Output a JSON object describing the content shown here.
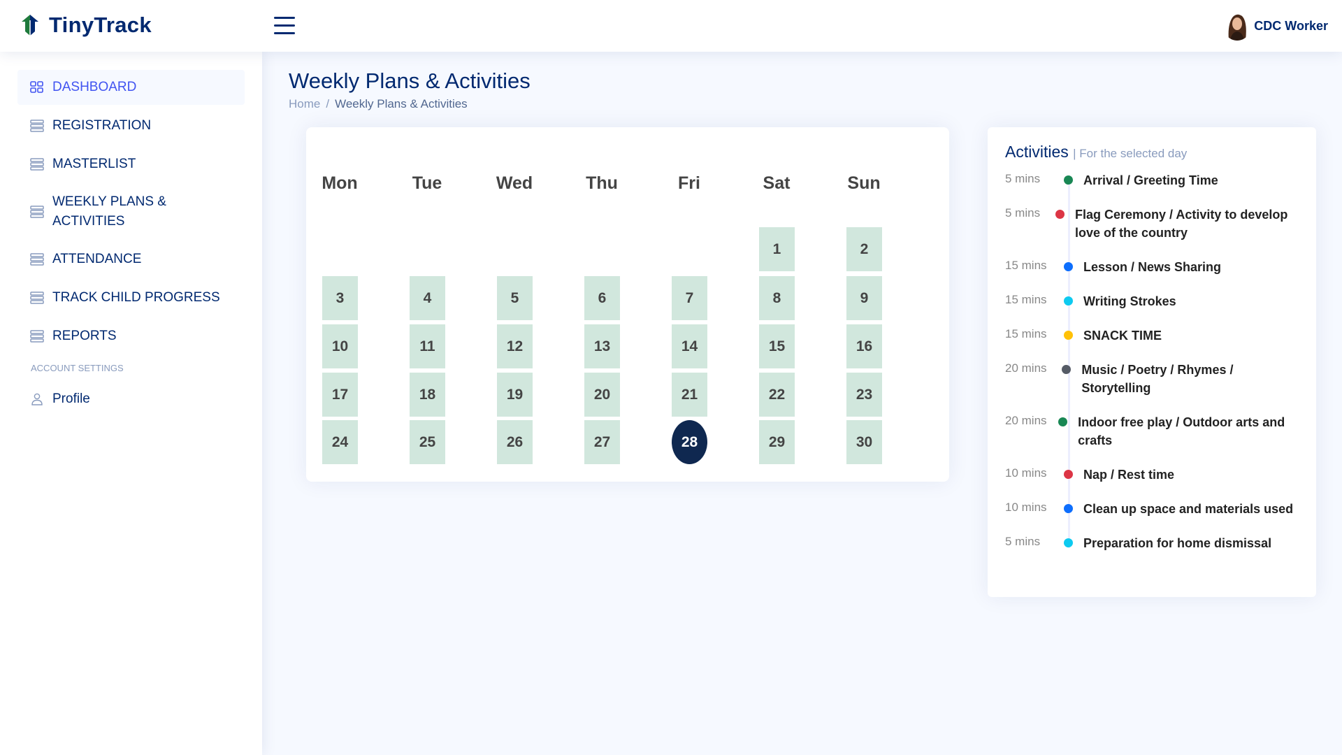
{
  "header": {
    "app_name": "TinyTrack",
    "user_name": "CDC Worker"
  },
  "sidebar": {
    "items": [
      {
        "label": "DASHBOARD"
      },
      {
        "label": "REGISTRATION"
      },
      {
        "label": "MASTERLIST"
      },
      {
        "label": "WEEKLY PLANS &\nACTIVITIES"
      },
      {
        "label": "ATTENDANCE"
      },
      {
        "label": "TRACK CHILD PROGRESS"
      },
      {
        "label": "REPORTS"
      }
    ],
    "section_heading": "ACCOUNT SETTINGS",
    "profile_label": "Profile"
  },
  "page": {
    "title": "Weekly Plans & Activities",
    "breadcrumb": {
      "home": "Home",
      "separator": "/",
      "current": "Weekly Plans & Activities"
    }
  },
  "calendar": {
    "weekdays": [
      "Mon",
      "Tue",
      "Wed",
      "Thu",
      "Fri",
      "Sat",
      "Sun"
    ],
    "days": [
      "1",
      "2",
      "3",
      "4",
      "5",
      "6",
      "7",
      "8",
      "9",
      "10",
      "11",
      "12",
      "13",
      "14",
      "15",
      "16",
      "17",
      "18",
      "19",
      "20",
      "21",
      "22",
      "23",
      "24",
      "25",
      "26",
      "27",
      "28",
      "29",
      "30"
    ],
    "first_weekday_index": 5,
    "selected_day": "28",
    "cell_color": "#d1e7dd",
    "selected_color": "#0f2850"
  },
  "activities": {
    "title": "Activities",
    "subtitle": "| For the selected day",
    "items": [
      {
        "time": "5 mins",
        "text": "Arrival / Greeting Time",
        "color": "#198754"
      },
      {
        "time": "5 mins",
        "text": "Flag Ceremony / Activity to develop love of the country",
        "color": "#dc3545"
      },
      {
        "time": "15 mins",
        "text": "Lesson / News Sharing",
        "color": "#0d6efd"
      },
      {
        "time": "15 mins",
        "text": "Writing Strokes",
        "color": "#0dcaf0"
      },
      {
        "time": "15 mins",
        "text": "SNACK TIME",
        "color": "#ffc107"
      },
      {
        "time": "20 mins",
        "text": "Music / Poetry / Rhymes / Storytelling",
        "color": "#555b66"
      },
      {
        "time": "20 mins",
        "text": "Indoor free play / Outdoor arts and crafts",
        "color": "#198754"
      },
      {
        "time": "10 mins",
        "text": "Nap / Rest time",
        "color": "#dc3545"
      },
      {
        "time": "10 mins",
        "text": "Clean up space and materials used",
        "color": "#0d6efd"
      },
      {
        "time": "5 mins",
        "text": "Preparation for home dismissal",
        "color": "#0dcaf0"
      }
    ]
  }
}
